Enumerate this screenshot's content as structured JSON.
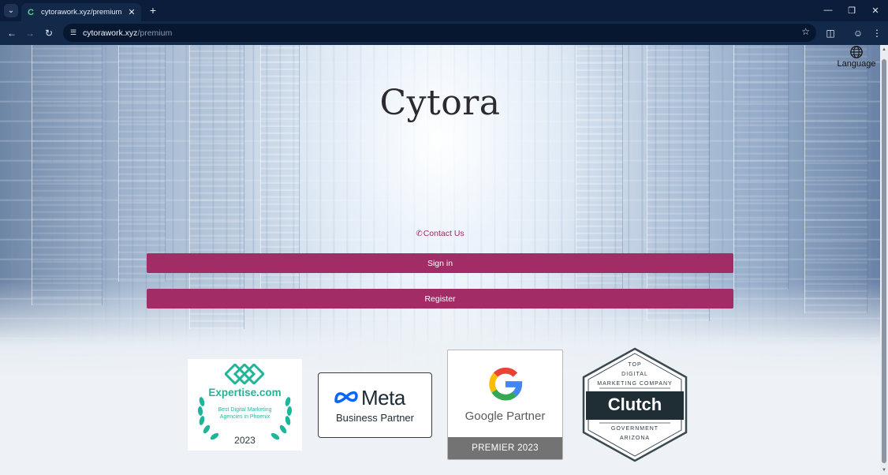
{
  "browser": {
    "tab_title": "cytorawork.xyz/premium",
    "tab_favicon": "C",
    "url_host": "cytorawork.xyz",
    "url_path": "/premium",
    "icons": {
      "tab_search": "chevron-down-icon",
      "new_tab": "plus-icon",
      "minimize": "minimize-icon",
      "restore": "restore-icon",
      "close": "close-icon",
      "back": "back-arrow-icon",
      "forward": "forward-arrow-icon",
      "reload": "reload-icon",
      "site_info": "tune-icon",
      "bookmark": "star-icon",
      "extensions": "puzzle-icon",
      "profile": "profile-icon",
      "menu": "kebab-menu-icon"
    }
  },
  "page": {
    "language_label": "Language",
    "brand": "Cytora",
    "contact_label": "Contact Us",
    "sign_in_label": "Sign in",
    "register_label": "Register",
    "accent_color": "#a12c66"
  },
  "badges": {
    "expertise": {
      "brand": "Expertise.com",
      "subtitle": "Best Digital Marketing Agencies in Phoenix",
      "year": "2023",
      "color": "#1fb59a"
    },
    "meta": {
      "name": "Meta",
      "subtitle": "Business Partner"
    },
    "google": {
      "label": "Google Partner",
      "tier": "PREMIER 2023"
    },
    "clutch": {
      "top": "TOP",
      "line1": "DIGITAL",
      "line2": "MARKETING COMPANY",
      "name": "Clutch",
      "line3": "GOVERNMENT",
      "line4": "ARIZONA"
    }
  }
}
